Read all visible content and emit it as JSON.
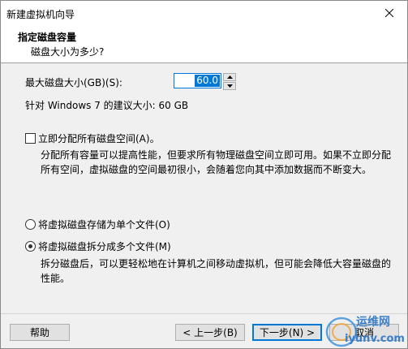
{
  "window": {
    "title": "新建虚拟机向导",
    "close_icon": "close-icon"
  },
  "header": {
    "title": "指定磁盘容量",
    "subtitle": "磁盘大小为多少?"
  },
  "disk": {
    "max_size_label": "最大磁盘大小(GB)(S):",
    "max_size_value": "60.0",
    "recommended_text": "针对 Windows 7 的建议大小: 60 GB"
  },
  "allocate": {
    "label": "立即分配所有磁盘空间(A)。",
    "checked": false,
    "description": "分配所有容量可以提高性能，但要求所有物理磁盘空间立即可用。如果不立即分配所有空间，虚拟磁盘的空间最初很小，会随着您向其中添加数据而不断变大。"
  },
  "storage": {
    "single_file_label": "将虚拟磁盘存储为单个文件(O)",
    "multi_file_label": "将虚拟磁盘拆分成多个文件(M)",
    "selected": "multi",
    "multi_description": "拆分磁盘后，可以更轻松地在计算机之间移动虚拟机，但可能会降低大容量磁盘的性能。"
  },
  "buttons": {
    "help": "帮助",
    "back": "< 上一步(B)",
    "next": "下一步(N) >",
    "cancel": "取消"
  },
  "watermark": {
    "text_cn": "运维网",
    "text_en": "iyunv.com"
  },
  "colors": {
    "accent": "#0078d7",
    "background": "#f0f0f0"
  }
}
